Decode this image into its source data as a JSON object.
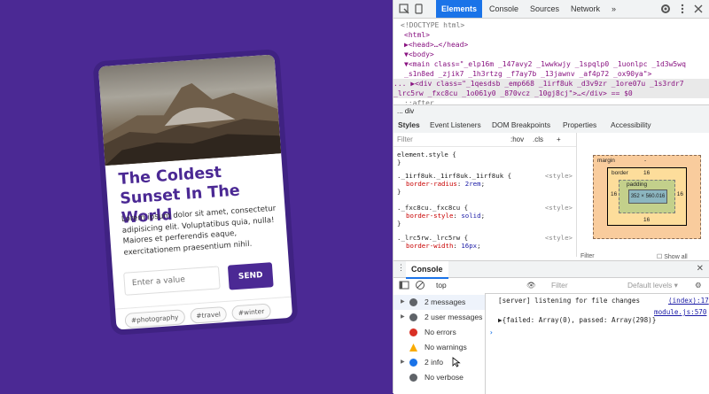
{
  "card": {
    "title": "The Coldest Sunset In The World",
    "body": "Lorem ipsum dolor sit amet, consectetur adipisicing elit. Voluptatibus quia, nulla! Maiores et perferendis eaque, exercitationem praesentium nihil.",
    "input_placeholder": "Enter a value",
    "send_label": "SEND",
    "tags": [
      "#photography",
      "#travel",
      "#winter"
    ]
  },
  "devtools": {
    "tabs": [
      "Elements",
      "Console",
      "Sources",
      "Network"
    ],
    "more": "»",
    "dom_lines": [
      "<!DOCTYPE html>",
      "<html>",
      "▶<head>…</head>",
      "▼<body>",
      "  ▼<main class=\"_elp16m _147avy2 _1wwkwjy _1spqlp0 _1uonlpc _1d3w5wq",
      "     _s1n8ed _zjik7 _1h3rtzg _f7ay7b _13jawnv _af4p72 _ox90ya\">",
      "...    ▶<div class=\"_1qesdsb _emp668 _1irf8uk _d3v9zr _1ore07u _1s3rdr7",
      "       _lrc5rw _fxc8cu _1o061y0 _870vcz _10gj8cj\">…</div> == $0",
      "        ::after"
    ],
    "crumb": "...   div",
    "subtabs": [
      "Styles",
      "Event Listeners",
      "DOM Breakpoints",
      "Properties",
      "Accessibility"
    ],
    "styles_filter": "Filter",
    "styles_hov": ":hov",
    "styles_cls": ".cls",
    "styles_add": "+",
    "rules": [
      {
        "selector": "element.style {",
        "props": [],
        "end": "}",
        "src": ""
      },
      {
        "selector": "._1irf8uk._1irf8uk._1irf8uk {",
        "props": [
          {
            "p": "border-radius",
            "v": "2rem"
          }
        ],
        "end": "}",
        "src": "<style>"
      },
      {
        "selector": "._fxc8cu._fxc8cu {",
        "props": [
          {
            "p": "border-style",
            "v": "solid"
          }
        ],
        "end": "}",
        "src": "<style>"
      },
      {
        "selector": "._lrc5rw._lrc5rw {",
        "props": [
          {
            "p": "border-width",
            "v": "16px"
          }
        ],
        "end": "",
        "src": "<style>"
      }
    ],
    "boxmodel": {
      "margin": "margin",
      "margin_value": "-",
      "border": "border",
      "border_value": "16",
      "padding": "padding",
      "padding_value": "-",
      "content": "352 × 560.016"
    },
    "filter2": "Filter",
    "show_all": "Show all",
    "console_title": "Console",
    "console_context": "top",
    "console_filter": "Filter",
    "console_levels": "Default levels ▾",
    "sidebar": [
      {
        "label": "2 messages",
        "color": "#5f6368",
        "tri": true,
        "sel": true
      },
      {
        "label": "2 user messages",
        "color": "#5f6368",
        "tri": true,
        "sel": false
      },
      {
        "label": "No errors",
        "color": "#d93025",
        "tri": false,
        "sel": false
      },
      {
        "label": "No warnings",
        "color": "#f9ab00",
        "tri": false,
        "sel": false
      },
      {
        "label": "2 info",
        "color": "#1a73e8",
        "tri": true,
        "sel": false
      },
      {
        "label": "No verbose",
        "color": "#5f6368",
        "tri": false,
        "sel": false
      }
    ],
    "console_msgs": [
      {
        "text": "[server] listening for file changes",
        "src": "(index):17"
      },
      {
        "text": "",
        "src": "module.js:570"
      },
      {
        "text": "▶{failed: Array(0), passed: Array(298)}",
        "src": ""
      }
    ],
    "prompt": "›"
  }
}
